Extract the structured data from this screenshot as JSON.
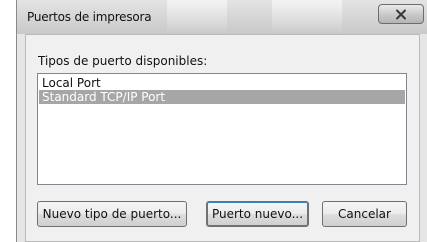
{
  "window": {
    "title": "Puertos de impresora"
  },
  "icons": {
    "close": "close-icon"
  },
  "ports": {
    "label": "Tipos de puerto disponibles:",
    "items": [
      {
        "label": "Local Port",
        "selected": false
      },
      {
        "label": "Standard TCP/IP Port",
        "selected": true
      }
    ]
  },
  "buttons": {
    "new_port_type": "Nuevo tipo de puerto...",
    "new_port": "Puerto nuevo...",
    "cancel": "Cancelar"
  },
  "colors": {
    "selection": "#a6a6a6",
    "dialog_background": "#f0f0f0"
  }
}
